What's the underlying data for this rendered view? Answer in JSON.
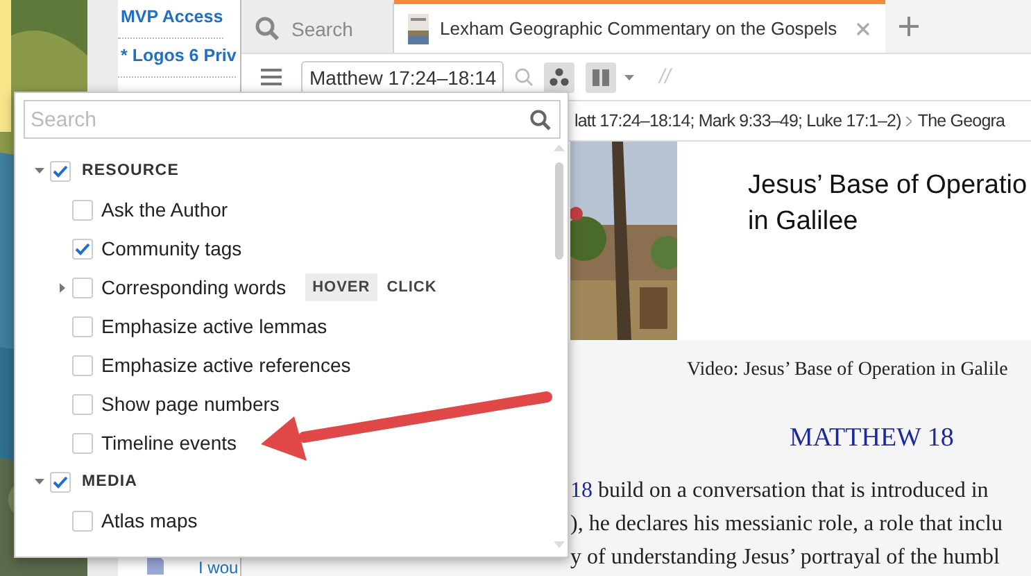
{
  "background_page": {
    "links": [
      {
        "text": "MVP Access"
      },
      {
        "text": "* Logos 6 Priv"
      }
    ],
    "footer_text": "I wou"
  },
  "window": {
    "tabs": [
      {
        "kind": "search",
        "label": "Search",
        "selected": false
      },
      {
        "kind": "resource",
        "label": "Lexham Geographic Commentary on the Gospels",
        "selected": true
      }
    ],
    "toolbar": {
      "reference": "Matthew 17:24–18:14",
      "visual_filters_active": true,
      "separator": "//"
    },
    "breadcrumb": [
      "latt 17:24–18:14; Mark 9:33–49; Luke 17:1–2)",
      "The Geogra"
    ],
    "article": {
      "subtitle": [
        "Jesus’ Base of Operatio",
        "in Galilee"
      ],
      "caption": "Video: Jesus’ Base of Operation in Galile",
      "section": "MATTHEW 18",
      "lines": [
        {
          "link": "18",
          "text": " build on a conversation that is introduced in"
        },
        {
          "text": "), he declares his messianic role, a role that inclu"
        },
        {
          "text": "y of understanding Jesus’ portrayal of the humbl"
        }
      ]
    }
  },
  "popup": {
    "search": {
      "placeholder": "Search"
    },
    "groups": [
      {
        "label": "RESOURCE",
        "checked": true,
        "expanded": true,
        "items": [
          {
            "label": "Ask the Author",
            "checked": false,
            "expandable": false
          },
          {
            "label": "Community tags",
            "checked": true,
            "expandable": false
          },
          {
            "label": "Corresponding words",
            "checked": false,
            "expandable": true,
            "modes": [
              {
                "label": "HOVER",
                "selected": true
              },
              {
                "label": "CLICK",
                "selected": false
              }
            ]
          },
          {
            "label": "Emphasize active lemmas",
            "checked": false,
            "expandable": false
          },
          {
            "label": "Emphasize active references",
            "checked": false,
            "expandable": false
          },
          {
            "label": "Show page numbers",
            "checked": false,
            "expandable": false
          },
          {
            "label": "Timeline events",
            "checked": false,
            "expandable": false
          }
        ]
      },
      {
        "label": "MEDIA",
        "checked": true,
        "expanded": true,
        "items": [
          {
            "label": "Atlas maps",
            "checked": false,
            "expandable": false
          }
        ]
      }
    ]
  }
}
